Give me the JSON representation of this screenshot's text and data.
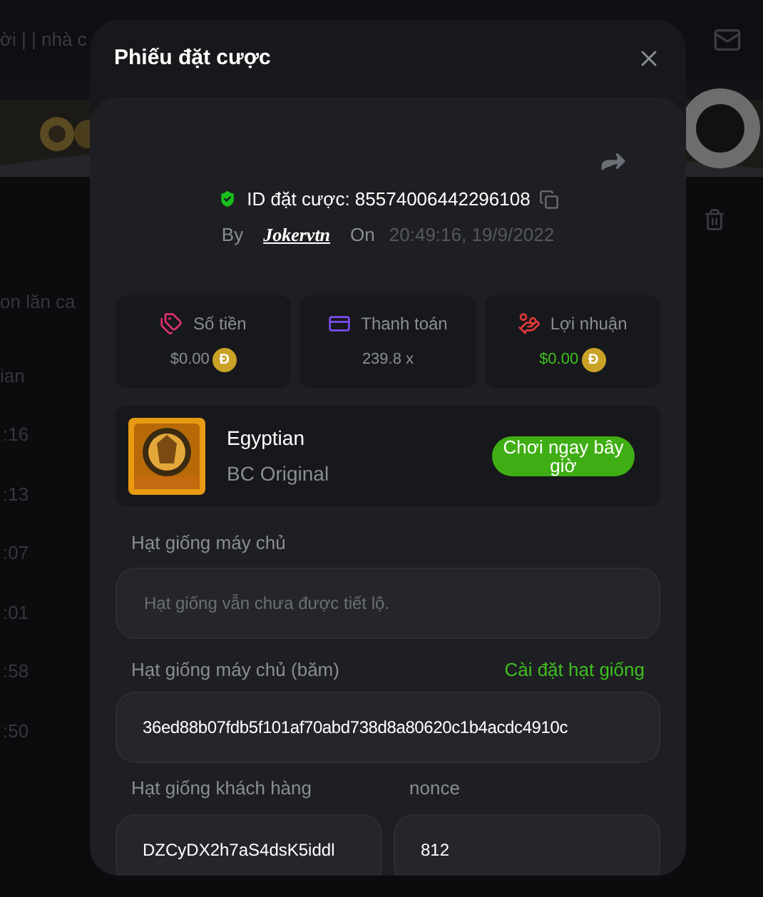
{
  "background": {
    "top_text": "ời | | nhà c",
    "column_header": "on lăn ca",
    "time_header": "ian",
    "times": [
      ":16",
      ":13",
      ":07",
      ":01",
      ":58",
      ":50"
    ]
  },
  "modal": {
    "title": "Phiếu đặt cược",
    "bet_id": "ID đặt cược: 85574006442296108",
    "by_label": "By",
    "user": "Jokervtn",
    "on_label": "On",
    "time": "20:49:16, 19/9/2022",
    "stats": [
      {
        "kind": "amount",
        "label": "Số tiền",
        "value": "$0.00",
        "coin": "Đ"
      },
      {
        "kind": "payout",
        "label": "Thanh toán",
        "value": "239.8 x"
      },
      {
        "kind": "profit",
        "label": "Lợi nhuận",
        "value": "$0.00",
        "coin": "Đ"
      }
    ],
    "game": {
      "name": "Egyptian",
      "provider": "BC Original",
      "play_button": "Chơi ngay bây giờ"
    },
    "server_seed": {
      "label": "Hạt giống máy chủ",
      "placeholder": "Hạt giống vẫn chưa được tiết lộ."
    },
    "server_seed_hash": {
      "label": "Hạt giống máy chủ (băm)",
      "link": "Cài đặt hạt giống",
      "value": "36ed88b07fdb5f101af70abd738d8a80620c1b4acdc4910c"
    },
    "client_seed": {
      "label": "Hạt giống khách hàng",
      "value": "DZCyDX2h7aS4dsK5iddl"
    },
    "nonce": {
      "label": "nonce",
      "value": "812"
    }
  }
}
